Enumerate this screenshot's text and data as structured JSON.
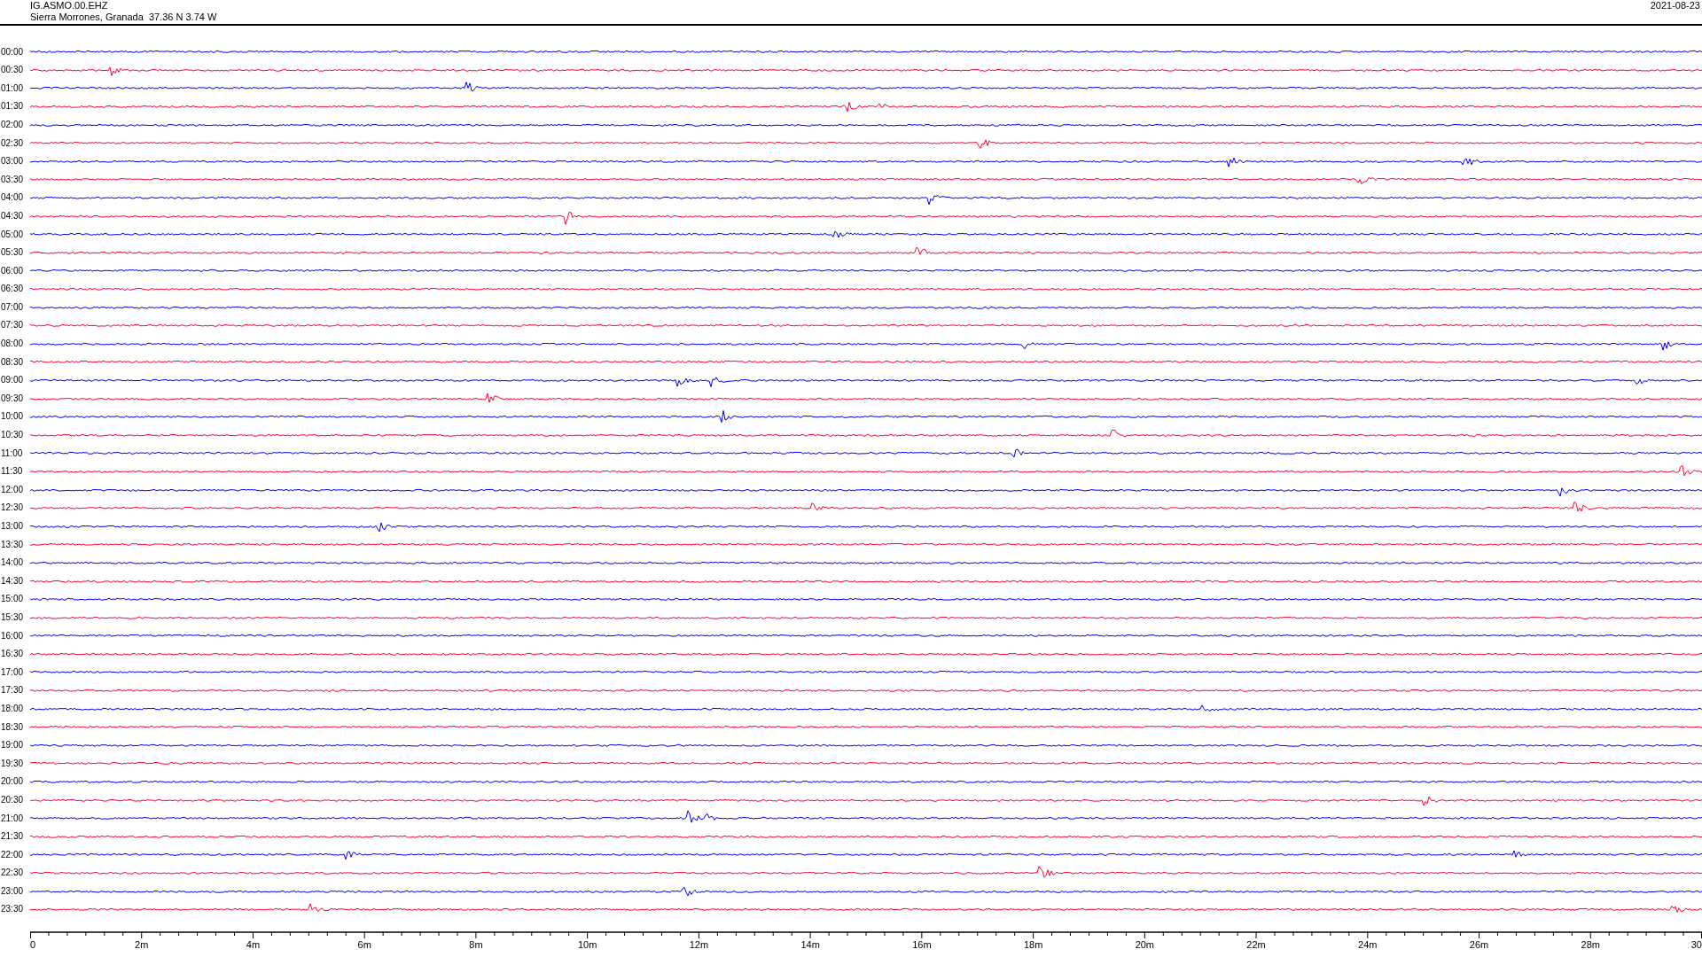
{
  "header": {
    "station": "IG.ASMO.00.EHZ",
    "location": "Sierra Morrones, Granada  37.36 N 3.74 W",
    "date": "2021-08-23"
  },
  "traces": [
    {
      "label": "00:00",
      "color": "#0000ff"
    },
    {
      "label": "00:30",
      "color": "#ff0033"
    },
    {
      "label": "01:00",
      "color": "#0000ff"
    },
    {
      "label": "01:30",
      "color": "#ff0033"
    },
    {
      "label": "02:00",
      "color": "#0000ff"
    },
    {
      "label": "02:30",
      "color": "#ff0033"
    },
    {
      "label": "03:00",
      "color": "#0000ff"
    },
    {
      "label": "03:30",
      "color": "#ff0033"
    },
    {
      "label": "04:00",
      "color": "#0000ff"
    },
    {
      "label": "04:30",
      "color": "#ff0033"
    },
    {
      "label": "05:00",
      "color": "#0000ff"
    },
    {
      "label": "05:30",
      "color": "#ff0033"
    },
    {
      "label": "06:00",
      "color": "#0000ff"
    },
    {
      "label": "06:30",
      "color": "#ff0033"
    },
    {
      "label": "07:00",
      "color": "#0000ff"
    },
    {
      "label": "07:30",
      "color": "#ff0033"
    },
    {
      "label": "08:00",
      "color": "#0000ff"
    },
    {
      "label": "08:30",
      "color": "#ff0033"
    },
    {
      "label": "09:00",
      "color": "#0000ff"
    },
    {
      "label": "09:30",
      "color": "#ff0033"
    },
    {
      "label": "10:00",
      "color": "#0000ff"
    },
    {
      "label": "10:30",
      "color": "#ff0033"
    },
    {
      "label": "11:00",
      "color": "#0000ff"
    },
    {
      "label": "11:30",
      "color": "#ff0033"
    },
    {
      "label": "12:00",
      "color": "#0000ff"
    },
    {
      "label": "12:30",
      "color": "#ff0033"
    },
    {
      "label": "13:00",
      "color": "#0000ff"
    },
    {
      "label": "13:30",
      "color": "#ff0033"
    },
    {
      "label": "14:00",
      "color": "#0000ff"
    },
    {
      "label": "14:30",
      "color": "#ff0033"
    },
    {
      "label": "15:00",
      "color": "#0000ff"
    },
    {
      "label": "15:30",
      "color": "#ff0033"
    },
    {
      "label": "16:00",
      "color": "#0000ff"
    },
    {
      "label": "16:30",
      "color": "#ff0033"
    },
    {
      "label": "17:00",
      "color": "#0000ff"
    },
    {
      "label": "17:30",
      "color": "#ff0033"
    },
    {
      "label": "18:00",
      "color": "#0000ff"
    },
    {
      "label": "18:30",
      "color": "#ff0033"
    },
    {
      "label": "19:00",
      "color": "#0000ff"
    },
    {
      "label": "19:30",
      "color": "#ff0033"
    },
    {
      "label": "20:00",
      "color": "#0000ff"
    },
    {
      "label": "20:30",
      "color": "#ff0033"
    },
    {
      "label": "21:00",
      "color": "#0000ff"
    },
    {
      "label": "21:30",
      "color": "#ff0033"
    },
    {
      "label": "22:00",
      "color": "#0000ff"
    },
    {
      "label": "22:30",
      "color": "#ff0033"
    },
    {
      "label": "23:00",
      "color": "#0000ff"
    },
    {
      "label": "23:30",
      "color": "#ff0033"
    }
  ],
  "axis": {
    "labels": [
      "0",
      "2m",
      "4m",
      "6m",
      "8m",
      "10m",
      "12m",
      "14m",
      "16m",
      "18m",
      "20m",
      "22m",
      "24m",
      "26m",
      "28m",
      "30"
    ]
  }
}
